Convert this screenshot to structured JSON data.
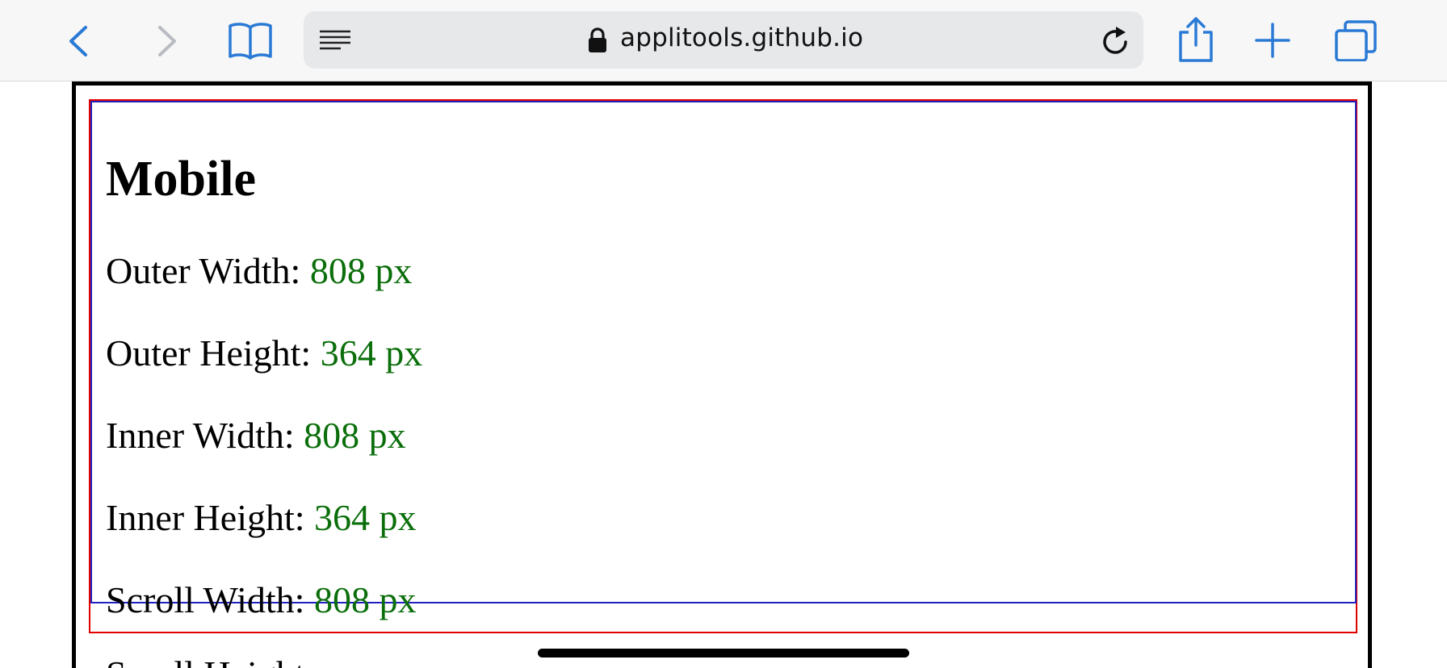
{
  "browser": {
    "url": "applitools.github.io",
    "icons": {
      "back": "chevron-left-icon",
      "forward": "chevron-right-icon",
      "bookmarks": "book-icon",
      "reader": "reader-lines-icon",
      "lock": "lock-icon",
      "reload": "reload-icon",
      "share": "share-icon",
      "new_tab": "plus-icon",
      "tabs": "tabs-icon"
    }
  },
  "page": {
    "heading": "Mobile",
    "rows": [
      {
        "label": "Outer Width: ",
        "value": "808 px"
      },
      {
        "label": "Outer Height: ",
        "value": "364 px"
      },
      {
        "label": "Inner Width: ",
        "value": "808 px"
      },
      {
        "label": "Inner Height: ",
        "value": "364 px"
      },
      {
        "label": "Scroll Width: ",
        "value": "808 px"
      }
    ],
    "clipped_row_label": "Scroll Height:"
  },
  "colors": {
    "value_text": "#0a6e0a",
    "outer_box_border": "#e00000",
    "inner_box_border": "#2020c0",
    "accent": "#2a7ad5"
  }
}
